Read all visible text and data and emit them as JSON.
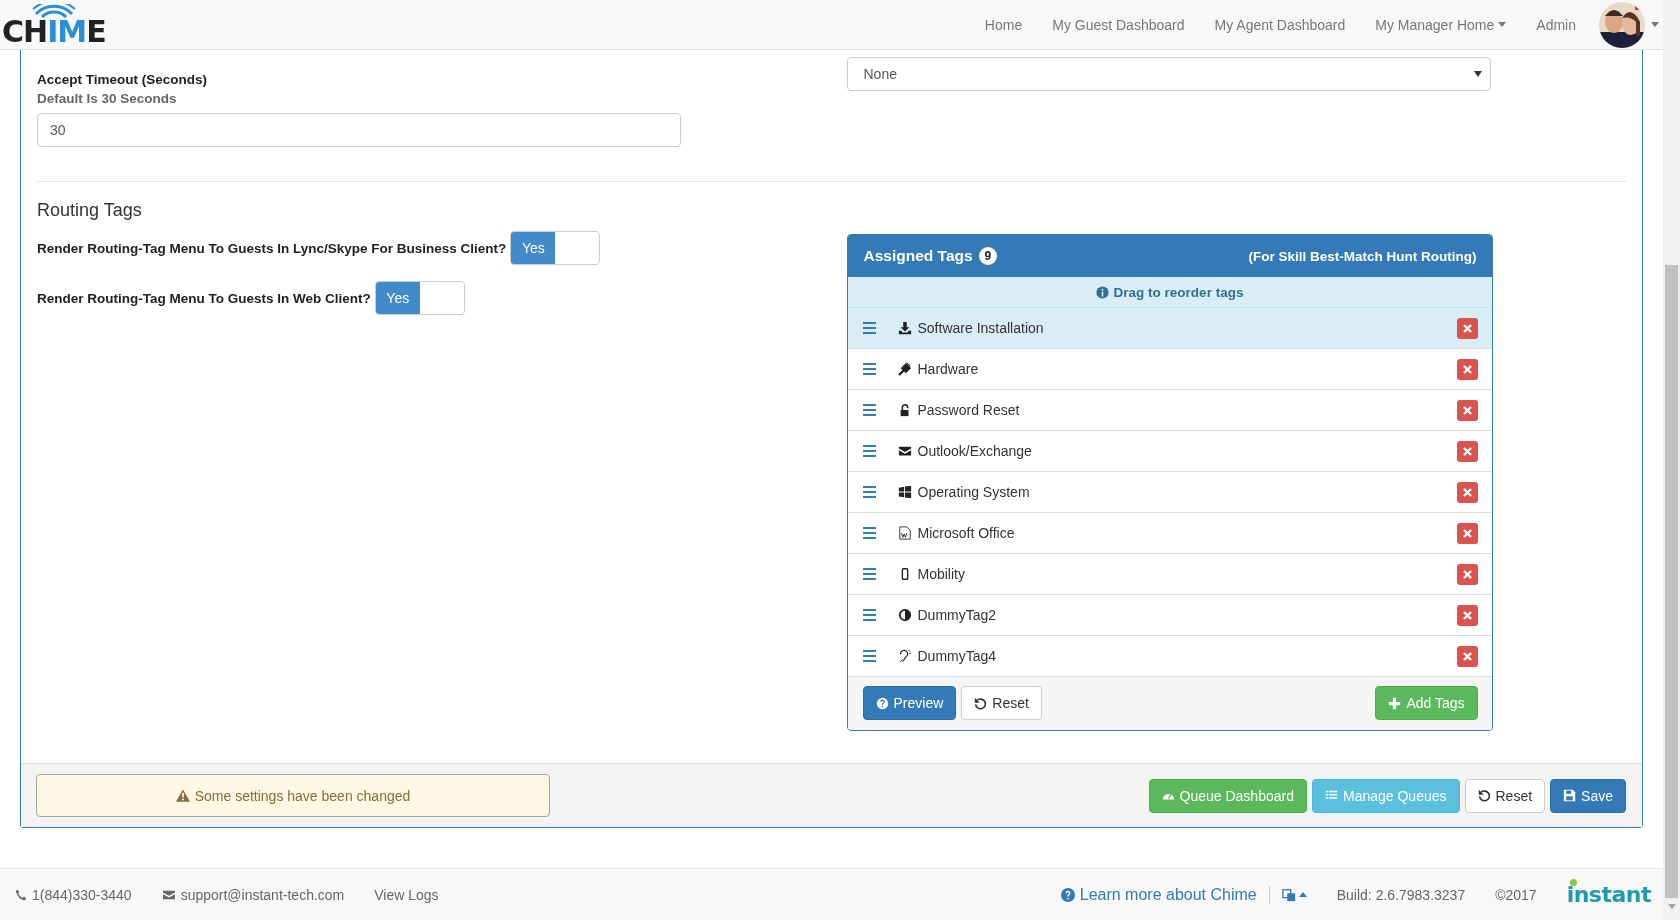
{
  "nav": {
    "logo": "CHIME",
    "links": [
      {
        "label": "Home",
        "dropdown": false
      },
      {
        "label": "My Guest Dashboard",
        "dropdown": false
      },
      {
        "label": "My Agent Dashboard",
        "dropdown": false
      },
      {
        "label": "My Manager Home",
        "dropdown": true
      },
      {
        "label": "Admin",
        "dropdown": false
      }
    ]
  },
  "timeout": {
    "label": "Accept Timeout (Seconds)",
    "hint": "Default Is 30 Seconds",
    "value": "30"
  },
  "rollover": {
    "value": "None"
  },
  "routing": {
    "title": "Routing Tags",
    "toggles": [
      {
        "label": "Render Routing-Tag Menu To Guests In Lync/Skype For Business Client?",
        "on_label": "Yes",
        "on": true
      },
      {
        "label": "Render Routing-Tag Menu To Guests In Web Client?",
        "on_label": "Yes",
        "on": true
      }
    ]
  },
  "tags_panel": {
    "title": "Assigned Tags",
    "count": "9",
    "subtitle": "(For Skill Best-Match Hunt Routing)",
    "hint": "Drag to reorder tags",
    "tags": [
      {
        "label": "Software Installation",
        "kind": "download",
        "selected": true
      },
      {
        "label": "Hardware",
        "kind": "plug",
        "selected": false
      },
      {
        "label": "Password Reset",
        "kind": "lock",
        "selected": false
      },
      {
        "label": "Outlook/Exchange",
        "kind": "mail",
        "selected": false
      },
      {
        "label": "Operating System",
        "kind": "windows",
        "selected": false
      },
      {
        "label": "Microsoft Office",
        "kind": "document",
        "selected": false
      },
      {
        "label": "Mobility",
        "kind": "phone",
        "selected": false
      },
      {
        "label": "DummyTag2",
        "kind": "contrast",
        "selected": false
      },
      {
        "label": "DummyTag4",
        "kind": "ear",
        "selected": false
      }
    ],
    "buttons": [
      {
        "label": "Preview",
        "kind": "preview"
      },
      {
        "label": "Reset",
        "kind": "reset"
      },
      {
        "label": "Add Tags",
        "kind": "add"
      }
    ]
  },
  "alert": {
    "text": "Some settings have been changed"
  },
  "actions": [
    {
      "label": "Queue Dashboard",
      "kind": "dashboard"
    },
    {
      "label": "Manage Queues",
      "kind": "manage"
    },
    {
      "label": "Reset",
      "kind": "reset"
    },
    {
      "label": "Save",
      "kind": "save"
    }
  ],
  "footer": {
    "phone": "1(844)330-3440",
    "email": "support@instant-tech.com",
    "logs": "View Logs",
    "learn": "Learn more about Chime",
    "build": "Build: 2.6.7983.3237",
    "copyright": "©2017",
    "brand": "instant"
  }
}
